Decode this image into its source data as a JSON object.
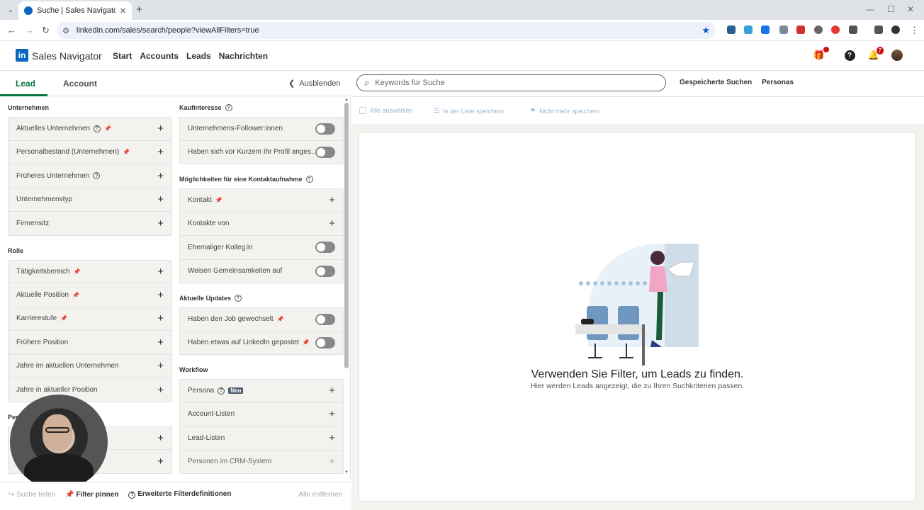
{
  "browser": {
    "tab_title": "Suche | Sales Navigator",
    "url": "linkedin.com/sales/search/people?viewAllFilters=true"
  },
  "header": {
    "logo_letters": "in",
    "app_name": "Sales Navigator",
    "nav": [
      "Start",
      "Accounts",
      "Leads",
      "Nachrichten"
    ],
    "notification_count": "7"
  },
  "left_panel": {
    "tabs": [
      "Lead",
      "Account"
    ],
    "hide_label": "Ausblenden",
    "col1": [
      {
        "title": "Unternehmen",
        "items": [
          {
            "label": "Aktuelles Unternehmen",
            "help": true,
            "pin": true
          },
          {
            "label": "Personalbestand (Unternehmen)",
            "pin": true
          },
          {
            "label": "Früheres Unternehmen",
            "help": true
          },
          {
            "label": "Unternehmenstyp"
          },
          {
            "label": "Firmensitz"
          }
        ]
      },
      {
        "title": "Rolle",
        "items": [
          {
            "label": "Tätigkeitsbereich",
            "pin": true
          },
          {
            "label": "Aktuelle Position",
            "pin": true
          },
          {
            "label": "Karrierestufe",
            "pin": true
          },
          {
            "label": "Frühere Position"
          },
          {
            "label": "Jahre im aktuellen Unternehmen"
          },
          {
            "label": "Jahre in aktueller Position"
          }
        ]
      },
      {
        "title": "Per",
        "items": [
          {
            "label": ""
          },
          {
            "label": ""
          }
        ]
      }
    ],
    "col2": [
      {
        "title": "Kaufinteresse",
        "help": true,
        "items": [
          {
            "label": "Unternehmens-Follower:innen",
            "toggle": true
          },
          {
            "label": "Haben sich vor Kurzem Ihr Profil anges...",
            "toggle": true
          }
        ]
      },
      {
        "title": "Möglichkeiten für eine Kontaktaufnahme",
        "help": true,
        "items": [
          {
            "label": "Kontakt",
            "pin": true
          },
          {
            "label": "Kontakte von"
          },
          {
            "label": "Ehemaliger Kolleg:in",
            "toggle": true
          },
          {
            "label": "Weisen Gemeinsamkeiten auf",
            "toggle": true
          }
        ]
      },
      {
        "title": "Aktuelle Updates",
        "help": true,
        "items": [
          {
            "label": "Haben den Job gewechselt",
            "pin": true,
            "toggle": true
          },
          {
            "label": "Haben etwas auf LinkedIn gepostet",
            "pin": true,
            "toggle": true
          }
        ]
      },
      {
        "title": "Workflow",
        "items": [
          {
            "label": "Persona",
            "help": true,
            "badge": "Neu"
          },
          {
            "label": "Account-Listen"
          },
          {
            "label": "Lead-Listen"
          },
          {
            "label": "Personen im CRM-System",
            "muted": true
          }
        ]
      }
    ],
    "footer": {
      "share": "Suche teilen",
      "pin": "Filter pinnen",
      "definitions": "Erweiterte Filterdefinitionen",
      "clear": "Alle entfernen"
    }
  },
  "main": {
    "search_placeholder": "Keywords für Suche",
    "saved_searches": "Gespeicherte Suchen",
    "personas": "Personas",
    "actions": {
      "select_all": "Alle auswählen",
      "save_to_list": "In der Liste speichern",
      "unsave": "Nicht mehr speichern"
    },
    "empty_title": "Verwenden Sie Filter, um Leads zu finden.",
    "empty_subtitle": "Hier werden Leads angezeigt, die zu Ihren Suchkriterien passen."
  },
  "colors": {
    "accent_green": "#057642",
    "linkedin_blue": "#0a66c2",
    "badge_red": "#cc1016"
  }
}
